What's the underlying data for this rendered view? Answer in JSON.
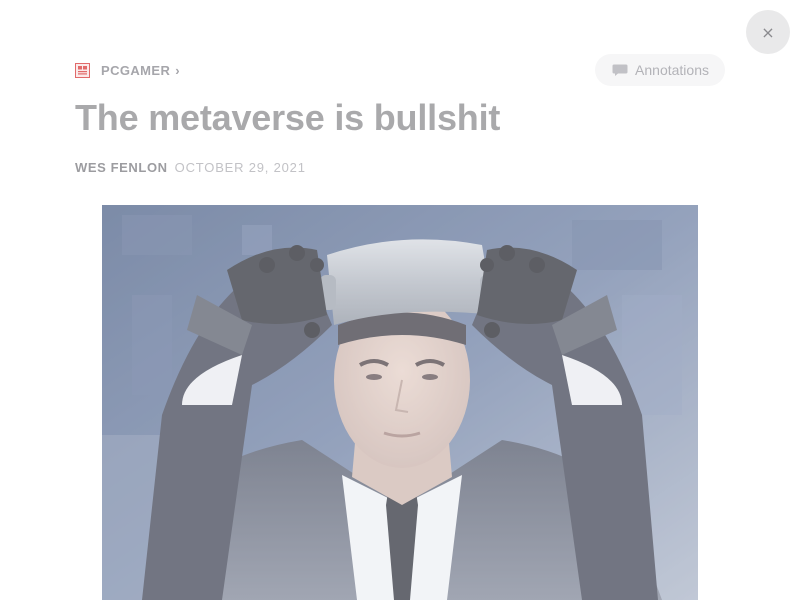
{
  "window": {
    "close_glyph": "×"
  },
  "source": {
    "name": "PCGAMER",
    "separator": "›",
    "logo_icon": "pcgamer-logo",
    "logo_color": "#e16a6a"
  },
  "toolbar": {
    "annotations_label": "Annotations",
    "annotations_icon": "comment-icon"
  },
  "article": {
    "title": "The metaverse is bullshit",
    "author": "WES FENLON",
    "date": "OCTOBER 29, 2021"
  },
  "colors": {
    "close_button_bg": "#e9e9ea",
    "title_text": "#a9a9ab",
    "muted_text": "#c2c2c6"
  }
}
